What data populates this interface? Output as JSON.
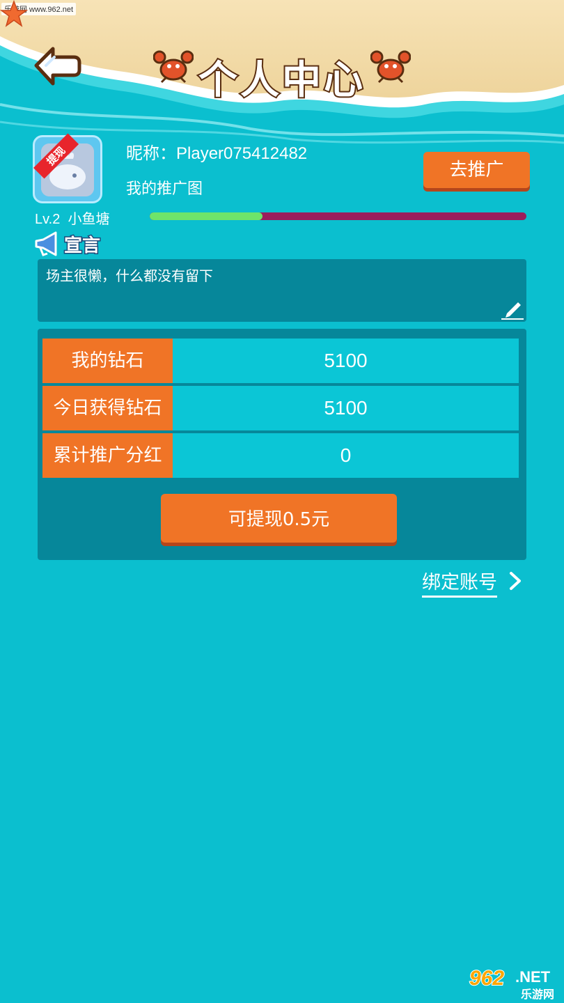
{
  "header": {
    "title": "个人中心",
    "watermark": "乐游网 www.962.net"
  },
  "profile": {
    "avatar_badge": "提现",
    "nickname_label": "昵称：",
    "nickname": "Player075412482",
    "promo_image_link": "我的推广图",
    "level": "Lv.2",
    "pond": "小鱼塘",
    "promote_button": "去推广",
    "level_progress": 0.3
  },
  "declaration": {
    "label": "宣言",
    "text": "场主很懒，什么都没有留下"
  },
  "stats": [
    {
      "label": "我的钻石",
      "value": "5100"
    },
    {
      "label": "今日获得钻石",
      "value": "5100"
    },
    {
      "label": "累计推广分红",
      "value": "0"
    }
  ],
  "withdraw_button": "可提现0.5元",
  "bind_account": "绑定账号",
  "footer_watermark": {
    "num": "962",
    "net": ".NET",
    "cn": "乐游网"
  },
  "colors": {
    "background": "#0bbfcf",
    "panel": "#06879a",
    "accent_orange": "#f07426",
    "progress_fill": "#6ee46a",
    "progress_track": "#9b1d5c"
  }
}
